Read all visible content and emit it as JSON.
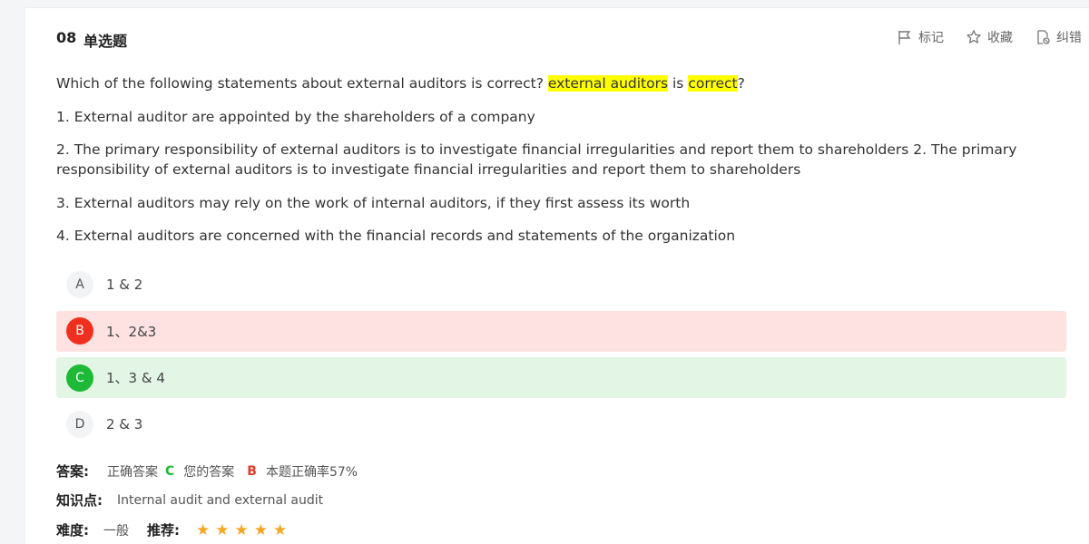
{
  "question": {
    "number": "08",
    "type": "单选题",
    "actions": [
      {
        "icon": "flag-icon",
        "label": "标记"
      },
      {
        "icon": "star-outline-icon",
        "label": "收藏"
      },
      {
        "icon": "report-error-icon",
        "label": "纠错"
      }
    ],
    "stem": {
      "prefix": "Which of the following statements about external auditors is correct? ",
      "highlight1": "external auditors",
      "middle": " is ",
      "highlight2": "correct",
      "suffix": "?"
    },
    "statements": [
      "1. External auditor are appointed by the shareholders of a company",
      "2. The primary responsibility of external auditors is to investigate financial irregularities and report them to shareholders 2. The primary responsibility of external auditors is to investigate financial irregularities and report them to shareholders",
      "3. External auditors may rely on the work of internal auditors, if they first assess its worth",
      "4. External auditors are concerned with the financial records and statements of the organization"
    ],
    "options": [
      {
        "letter": "A",
        "text": "1 & 2",
        "state": "normal"
      },
      {
        "letter": "B",
        "text": "1、2&3",
        "state": "wrong"
      },
      {
        "letter": "C",
        "text": "1、3 & 4",
        "state": "correct"
      },
      {
        "letter": "D",
        "text": "2 & 3",
        "state": "normal"
      }
    ]
  },
  "result": {
    "answer_label": "答案:",
    "correct_label": "正确答案",
    "correct_value": "C",
    "yours_label": "您的答案",
    "yours_value": "B",
    "rate_text": "本题正确率57%",
    "knowledge_label": "知识点:",
    "knowledge_value": "Internal audit and external audit",
    "difficulty_label": "难度:",
    "difficulty_value": "一般",
    "recommend_label": "推荐:",
    "recommend_stars": 5
  },
  "colors": {
    "wrong": "#f0301e",
    "correct": "#1fb938",
    "highlight": "#ffff00",
    "star": "#f5a623"
  }
}
